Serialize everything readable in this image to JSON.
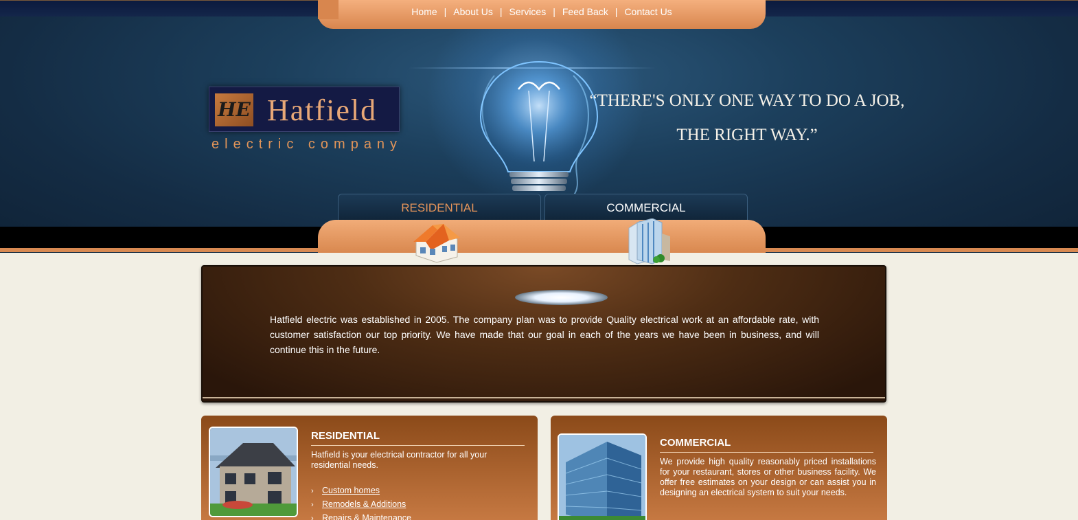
{
  "nav": {
    "items": [
      "Home",
      "About Us",
      "Services",
      "Feed Back",
      "Contact Us"
    ],
    "separator": "|"
  },
  "logo": {
    "monogram": "HE",
    "name": "Hatfield",
    "subtitle": "electric company"
  },
  "quote": {
    "line1": "“THERE'S ONLY ONE WAY TO DO A  JOB,",
    "line2": "THE RIGHT WAY.”"
  },
  "category_tabs": {
    "residential": "RESIDENTIAL",
    "commercial": "COMMERCIAL"
  },
  "hero": {
    "text": "Hatfield electric was established in 2005. The company plan was to provide Quality electrical work at an affordable rate, with customer satisfaction our top priority. We have made that our goal in each of the years we have been in business, and will continue this in the future."
  },
  "cards": {
    "residential": {
      "title": "RESIDENTIAL",
      "description": "Hatfield is your electrical contractor for all your residential needs.",
      "links": [
        "Custom homes",
        "Remodels & Additions",
        "Repairs & Maintenance"
      ],
      "chevron": "›"
    },
    "commercial": {
      "title": "COMMERCIAL",
      "description": "We provide high quality reasonably priced installations for your restaurant, stores or other business facility. We offer free estimates on your design or can assist you in designing an electrical system to suit your needs."
    }
  },
  "colors": {
    "accent_orange": "#d98a52",
    "header_blue": "#1c3f5c",
    "logo_navy": "#141a44",
    "page_bg": "#f2efe4"
  },
  "icons": {
    "house": "house-icon",
    "building": "office-building-icon",
    "bulb": "light-bulb-illustration"
  }
}
